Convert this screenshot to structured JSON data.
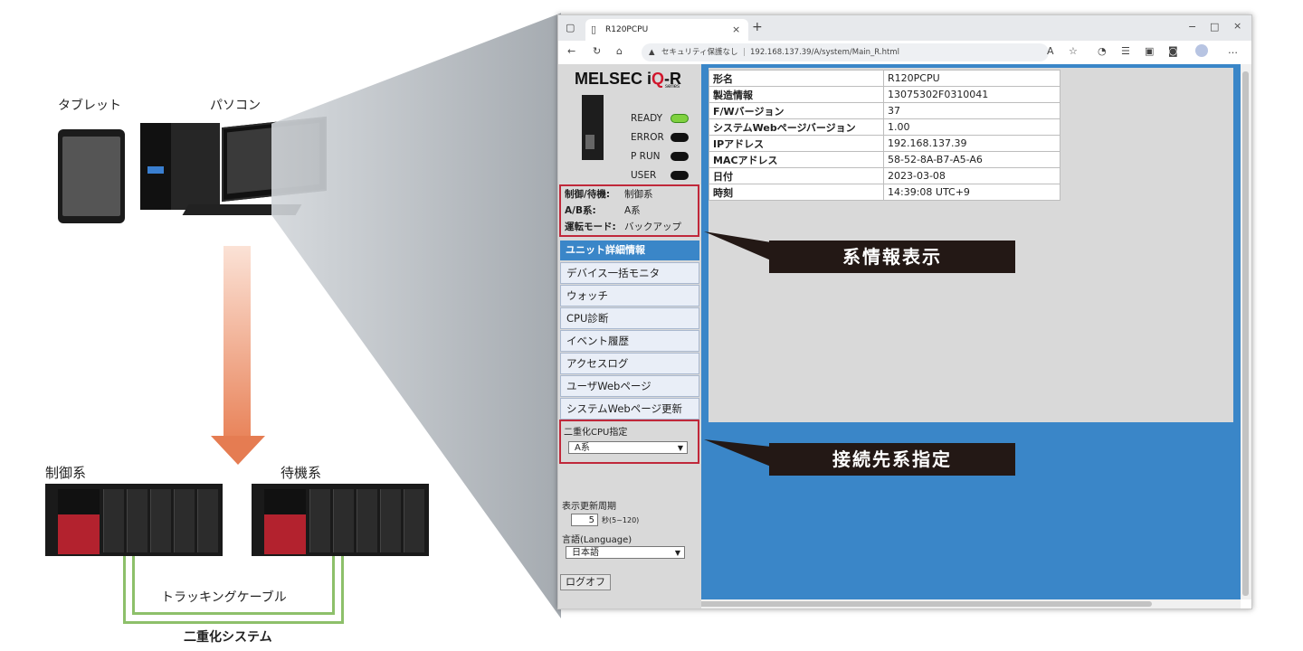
{
  "left": {
    "tablet_label": "タブレット",
    "pc_label": "パソコン",
    "control_label": "制御系",
    "standby_label": "待機系",
    "cable_label": "トラッキングケーブル",
    "system_label": "二重化システム"
  },
  "browser": {
    "tab_title": "R120PCPU",
    "security": "セキュリティ保護なし",
    "url": "192.168.137.39/A/system/Main_R.html"
  },
  "sidebar": {
    "logo_main": "MELSEC i",
    "logo_q": "Q",
    "logo_r": "-R",
    "logo_sub": "series",
    "leds": [
      {
        "label": "READY",
        "state": "on"
      },
      {
        "label": "ERROR",
        "state": "off"
      },
      {
        "label": "P RUN",
        "state": "off"
      },
      {
        "label": "USER",
        "state": "off"
      }
    ],
    "system_info": [
      {
        "key": "制御/待機:",
        "value": "制御系"
      },
      {
        "key": "A/B系:",
        "value": "A系"
      },
      {
        "key": "運転モード:",
        "value": "バックアップ"
      }
    ],
    "menu_header": "ユニット詳細情報",
    "menu": [
      "デバイス一括モニタ",
      "ウォッチ",
      "CPU診断",
      "イベント履歴",
      "アクセスログ",
      "ユーザWebページ",
      "システムWebページ更新"
    ],
    "dual_cpu_label": "二重化CPU指定",
    "dual_cpu_value": "A系",
    "refresh_label": "表示更新周期",
    "refresh_value": "5",
    "refresh_unit": "秒(5~120)",
    "language_label": "言語(Language)",
    "language_value": "日本語",
    "logoff": "ログオフ"
  },
  "info_table": [
    {
      "key": "形名",
      "value": "R120PCPU"
    },
    {
      "key": "製造情報",
      "value": "13075302F0310041"
    },
    {
      "key": "F/Wバージョン",
      "value": "37"
    },
    {
      "key": "システムWebページバージョン",
      "value": "1.00"
    },
    {
      "key": "IPアドレス",
      "value": "192.168.137.39"
    },
    {
      "key": "MACアドレス",
      "value": "58-52-8A-B7-A5-A6"
    },
    {
      "key": "日付",
      "value": "2023-03-08"
    },
    {
      "key": "時刻",
      "value": "14:39:08 UTC+9"
    }
  ],
  "callouts": {
    "system_info": "系情報表示",
    "connection": "接続先系指定"
  },
  "colors": {
    "accent_blue": "#3a86c8",
    "highlight_red": "#c0283a",
    "callout_bg": "#231815",
    "ready_led": "#7fd13f",
    "cable_green": "#8dc06a"
  }
}
